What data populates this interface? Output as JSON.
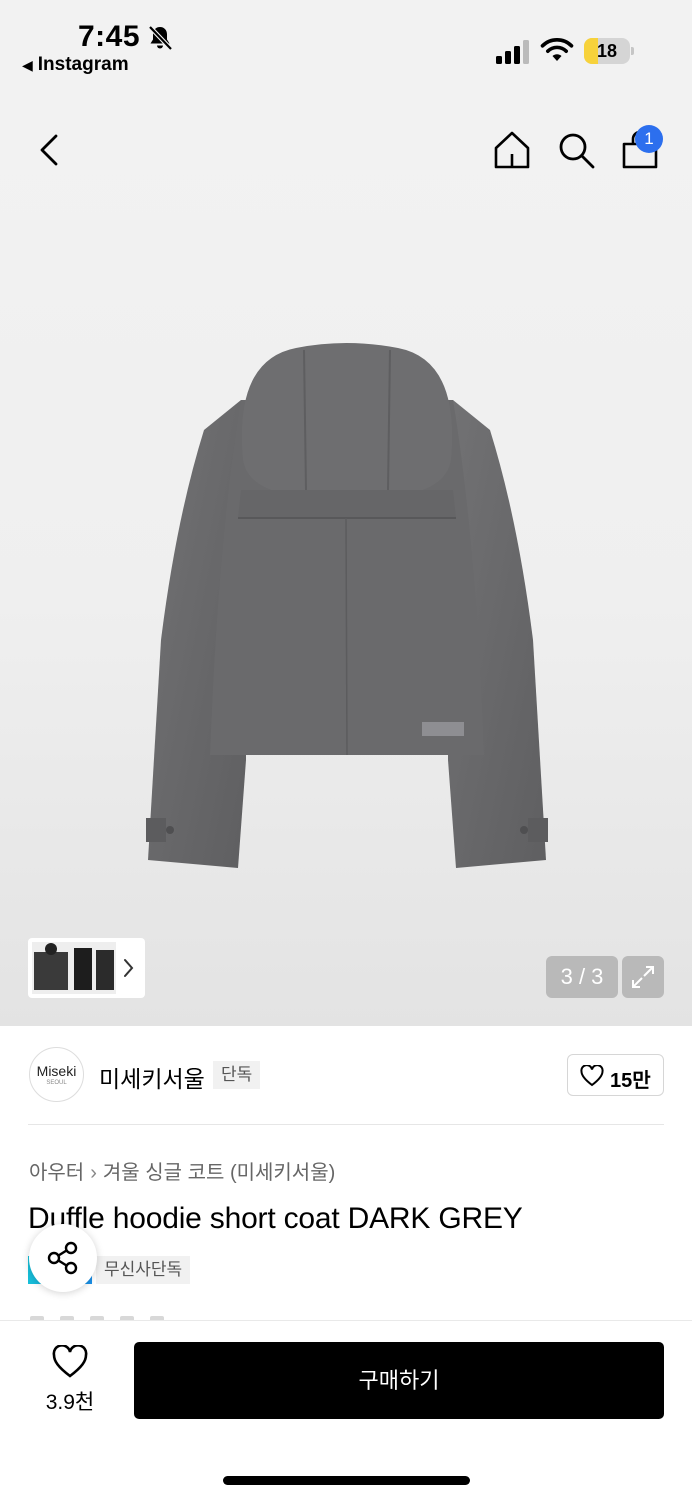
{
  "status_bar": {
    "time": "7:45",
    "back_app": "Instagram",
    "battery": "18",
    "battery_level": 0.18
  },
  "nav": {
    "cart_badge": "1"
  },
  "gallery": {
    "page_indicator": "3 / 3"
  },
  "brand": {
    "logo_text": "Miseki",
    "logo_sub": "SEOUL",
    "name": "미세키서울",
    "tag": "단독",
    "like_count": "15만"
  },
  "product": {
    "breadcrumb": [
      "아우터",
      "겨울 싱글 코트 (미세키서울)"
    ],
    "title": "Duffle hoodie short coat DARK GREY",
    "exclusive_tag": "무신사단독"
  },
  "bottom": {
    "wish_count": "3.9천",
    "buy_label": "구매하기"
  },
  "colors": {
    "accent_blue": "#2c6fee",
    "battery_yellow": "#f7d23b",
    "coat_grey": "#6b6b6d"
  }
}
